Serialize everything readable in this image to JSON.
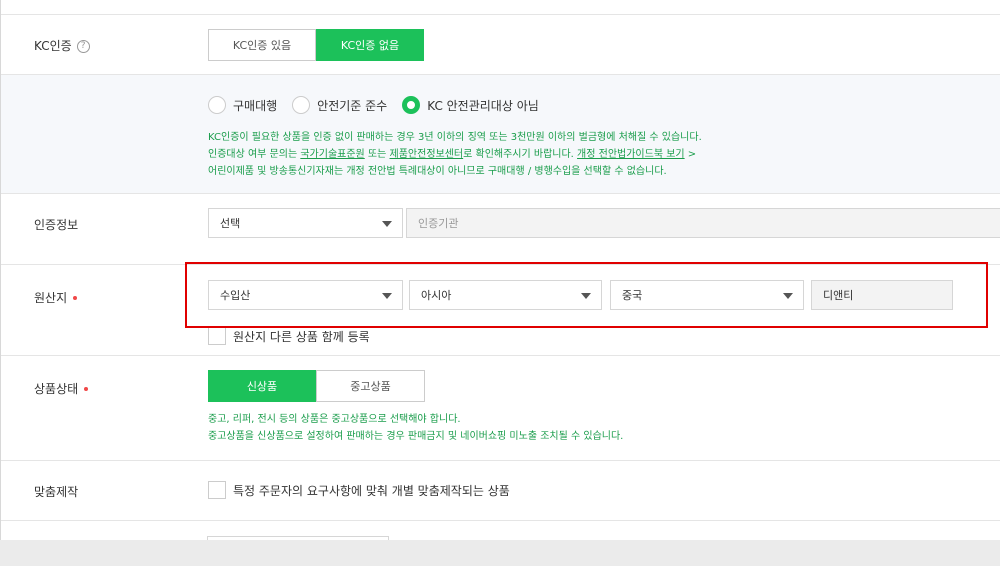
{
  "kc": {
    "label": "KC인증",
    "options": [
      "KC인증 있음",
      "KC인증 없음"
    ],
    "selected_index": 1,
    "radios": [
      "구매대행",
      "안전기준 준수",
      "KC 안전관리대상 아님"
    ],
    "radio_selected": 2,
    "notice_line1": "KC인증이 필요한 상품을 인증 없이 판매하는 경우 3년 이하의 징역 또는 3천만원 이하의 벌금형에 처해질 수 있습니다.",
    "notice_line2_a": "인증대상 여부 문의는 ",
    "notice_line2_link1": "국가기술표준원",
    "notice_line2_b": " 또는 ",
    "notice_line2_link2": "제품안전정보센터",
    "notice_line2_c": "로 확인해주시기 바랍니다. ",
    "notice_line2_link3": "개정 전안법가이드북 보기",
    "notice_line2_arrow": " >",
    "notice_line3": "어린이제품 및 방송통신기자재는 개정 전안법 특례대상이 아니므로 구매대행 / 병행수입을 선택할 수 없습니다."
  },
  "cert": {
    "label": "인증정보",
    "select_value": "선택",
    "agency_placeholder": "인증기관"
  },
  "origin": {
    "label": "원산지",
    "type_value": "수입산",
    "region_value": "아시아",
    "country_value": "중국",
    "importer_value": "디앤티",
    "register_label": "원산지 다른 상품 함께 등록"
  },
  "condition": {
    "label": "상품상태",
    "options": [
      "신상품",
      "중고상품"
    ],
    "selected_index": 0,
    "notice_line1": "중고, 리퍼, 전시 등의 상품은 중고상품으로 선택해야 합니다.",
    "notice_line2": "중고상품을 신상품으로 설정하여 판매하는 경우 판매금지 및 네이버쇼핑 미노출 조치될 수 있습니다."
  },
  "custom": {
    "label": "맞춤제작",
    "checkbox_label": "특정 주문자의 요구사항에 맞춰 개별 맞춤제작되는 상품"
  },
  "colors": {
    "accent": "#1cc15a",
    "notice_green": "#1a9d4b",
    "required_dot": "#f04848",
    "highlight_red": "#e00000"
  }
}
